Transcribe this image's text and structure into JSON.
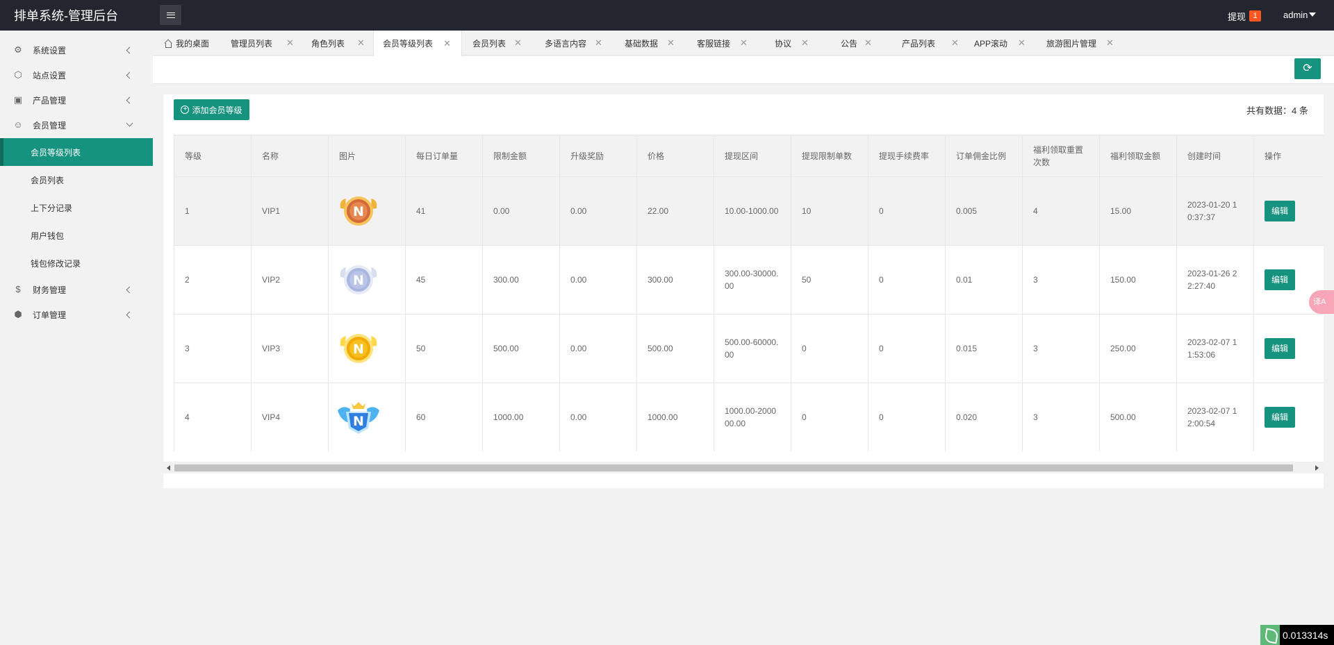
{
  "header": {
    "title": "排单系统-管理后台",
    "withdraw_label": "提现",
    "withdraw_count": "1",
    "user": "admin"
  },
  "sidebar": {
    "groups": [
      {
        "label": "系统设置",
        "icon": "gear-icon"
      },
      {
        "label": "站点设置",
        "icon": "site-icon"
      },
      {
        "label": "产品管理",
        "icon": "box-icon"
      },
      {
        "label": "会员管理",
        "icon": "user-icon"
      },
      {
        "label": "财务管理",
        "icon": "dollar-icon"
      },
      {
        "label": "订单管理",
        "icon": "cube-icon"
      }
    ],
    "member_sub": [
      {
        "label": "会员等级列表",
        "active": true
      },
      {
        "label": "会员列表"
      },
      {
        "label": "上下分记录"
      },
      {
        "label": "用户钱包"
      },
      {
        "label": "钱包修改记录"
      }
    ]
  },
  "tabs": [
    {
      "label": "我的桌面"
    },
    {
      "label": "管理员列表"
    },
    {
      "label": "角色列表"
    },
    {
      "label": "会员等级列表",
      "active": true
    },
    {
      "label": "会员列表"
    },
    {
      "label": "多语言内容"
    },
    {
      "label": "基础数据"
    },
    {
      "label": "客服链接"
    },
    {
      "label": "协议"
    },
    {
      "label": "公告"
    },
    {
      "label": "产品列表"
    },
    {
      "label": "APP滚动"
    },
    {
      "label": "旅游图片管理"
    }
  ],
  "toolbar": {
    "add_label": "添加会员等级",
    "total_label": "共有数据：4 条"
  },
  "table": {
    "headers": [
      "等级",
      "名称",
      "图片",
      "每日订单量",
      "限制金额",
      "升级奖励",
      "价格",
      "提现区间",
      "提现限制单数",
      "提现手续费率",
      "订单佣金比例",
      "福利领取重置次数",
      "福利领取金额",
      "创建时间",
      "操作"
    ],
    "edit_label": "编辑",
    "rows": [
      {
        "level": "1",
        "name": "VIP1",
        "badge": "bronze",
        "daily": "41",
        "limit": "0.00",
        "reward": "0.00",
        "price": "22.00",
        "range": "10.00-1000.00",
        "wd_count": "10",
        "fee": "0",
        "commission": "0.005",
        "reset": "4",
        "welfare": "15.00",
        "created": "2023-01-20 10:37:37"
      },
      {
        "level": "2",
        "name": "VIP2",
        "badge": "silver",
        "daily": "45",
        "limit": "300.00",
        "reward": "0.00",
        "price": "300.00",
        "range": "300.00-30000.00",
        "wd_count": "50",
        "fee": "0",
        "commission": "0.01",
        "reset": "3",
        "welfare": "150.00",
        "created": "2023-01-26 22:27:40"
      },
      {
        "level": "3",
        "name": "VIP3",
        "badge": "gold",
        "daily": "50",
        "limit": "500.00",
        "reward": "0.00",
        "price": "500.00",
        "range": "500.00-60000.00",
        "wd_count": "0",
        "fee": "0",
        "commission": "0.015",
        "reset": "3",
        "welfare": "250.00",
        "created": "2023-02-07 11:53:06"
      },
      {
        "level": "4",
        "name": "VIP4",
        "badge": "diamond",
        "daily": "60",
        "limit": "1000.00",
        "reward": "0.00",
        "price": "1000.00",
        "range": "1000.00-200000.00",
        "wd_count": "0",
        "fee": "0",
        "commission": "0.020",
        "reset": "3",
        "welfare": "500.00",
        "created": "2023-02-07 12:00:54"
      }
    ]
  },
  "footer": {
    "timer": "0.013314s",
    "translate_label": "译A"
  },
  "colors": {
    "accent": "#16937f",
    "header_bg": "#23262e",
    "badge": "#ff5722"
  }
}
